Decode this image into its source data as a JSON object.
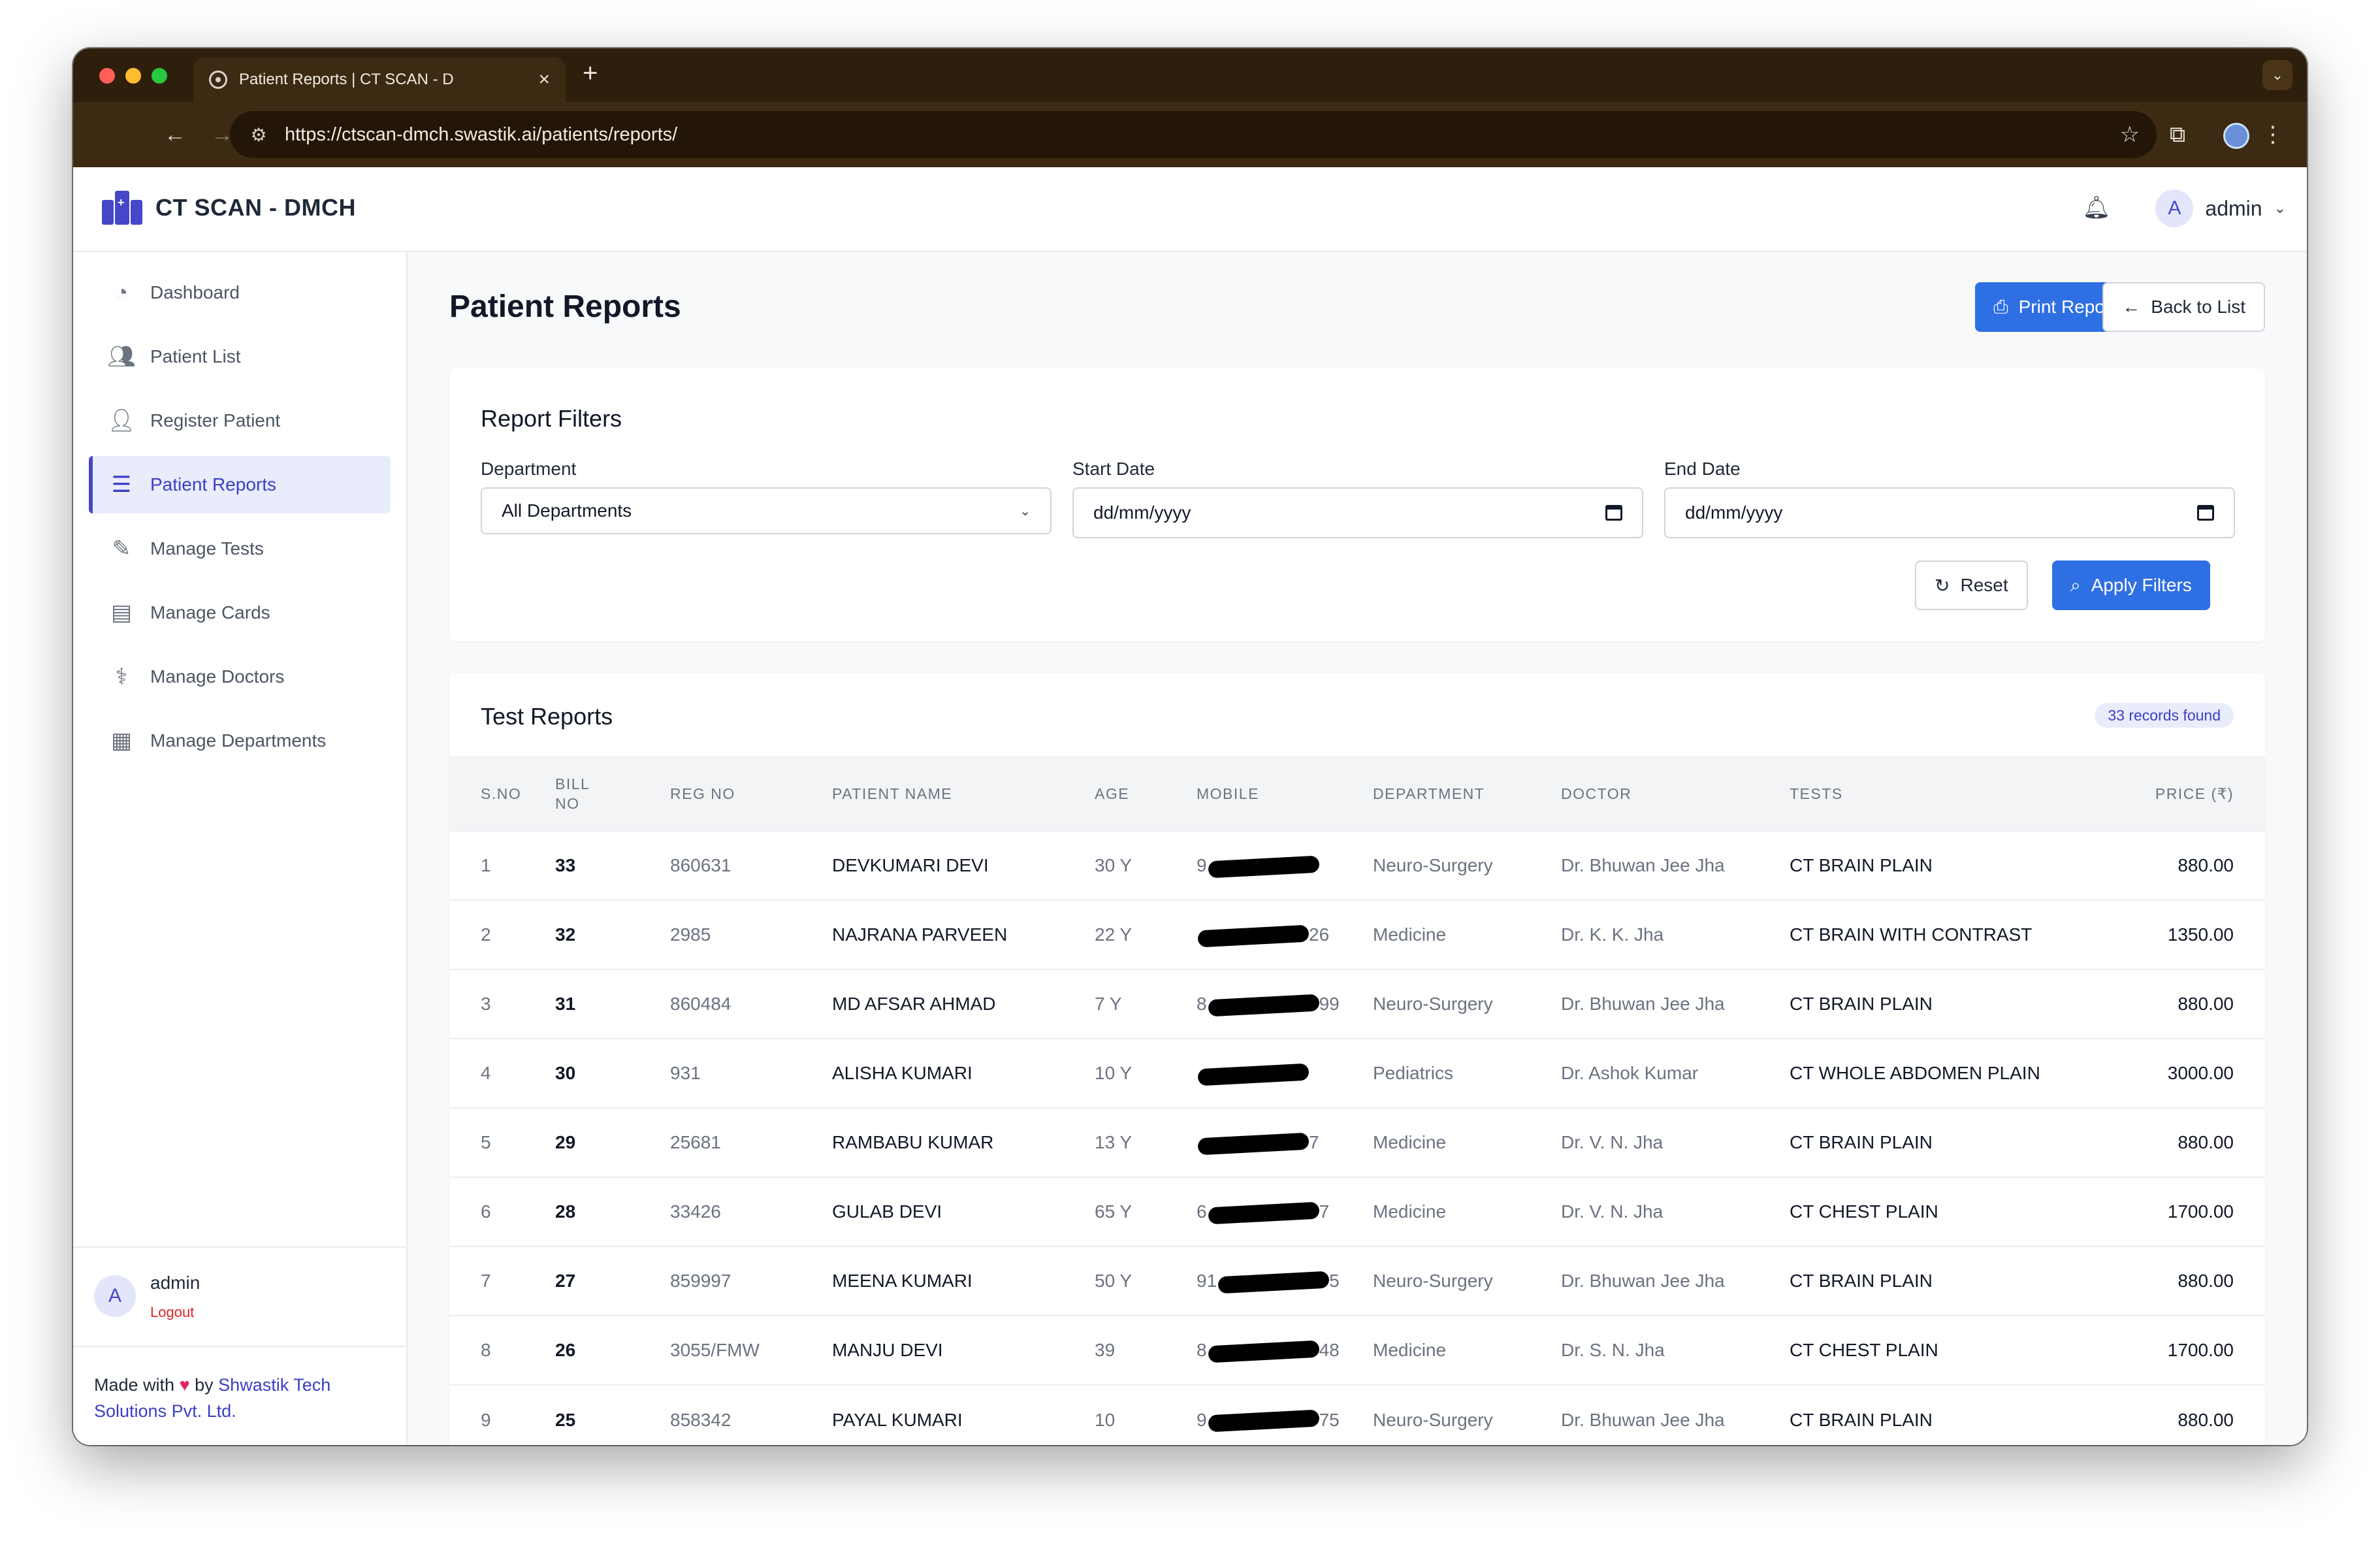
{
  "browser": {
    "tab_title": "Patient Reports | CT SCAN - D",
    "url": "https://ctscan-dmch.swastik.ai/patients/reports/"
  },
  "app": {
    "brand": "CT SCAN - DMCH",
    "user_name": "admin",
    "user_initial": "A"
  },
  "sidebar": {
    "items": [
      {
        "label": "Dashboard",
        "icon": "gauge-icon"
      },
      {
        "label": "Patient List",
        "icon": "users-icon"
      },
      {
        "label": "Register Patient",
        "icon": "user-plus-icon"
      },
      {
        "label": "Patient Reports",
        "icon": "chart-bar-icon"
      },
      {
        "label": "Manage Tests",
        "icon": "syringe-icon"
      },
      {
        "label": "Manage Cards",
        "icon": "id-card-icon"
      },
      {
        "label": "Manage Doctors",
        "icon": "user-doctor-icon"
      },
      {
        "label": "Manage Departments",
        "icon": "building-icon"
      }
    ],
    "footer_user": "admin",
    "footer_initial": "A",
    "logout": "Logout",
    "made_with_prefix": "Made with",
    "made_with_by": "by",
    "company": "Shwastik Tech Solutions Pvt. Ltd."
  },
  "page": {
    "title": "Patient Reports",
    "print_button": "Print Report",
    "back_button": "Back to List"
  },
  "filters": {
    "title": "Report Filters",
    "department_label": "Department",
    "department_value": "All Departments",
    "start_label": "Start Date",
    "start_value": "dd/mm/yyyy",
    "end_label": "End Date",
    "end_value": "dd/mm/yyyy",
    "reset": "Reset",
    "apply": "Apply Filters"
  },
  "reports": {
    "title": "Test Reports",
    "badge": "33 records found",
    "columns": {
      "sno": "S.NO",
      "bill_line1": "BILL",
      "bill_line2": "NO",
      "reg": "REG NO",
      "name": "PATIENT NAME",
      "age": "AGE",
      "mobile": "MOBILE",
      "dept": "DEPARTMENT",
      "doctor": "DOCTOR",
      "tests": "TESTS",
      "price": "PRICE (₹)"
    },
    "rows": [
      {
        "sno": "1",
        "bill": "33",
        "reg": "860631",
        "name": "DEVKUMARI DEVI",
        "age": "30 Y",
        "mob_a": "9",
        "mob_b": "",
        "dept": "Neuro-Surgery",
        "doctor": "Dr. Bhuwan Jee Jha",
        "test": "CT BRAIN PLAIN",
        "price": "880.00"
      },
      {
        "sno": "2",
        "bill": "32",
        "reg": "2985",
        "name": "NAJRANA PARVEEN",
        "age": "22 Y",
        "mob_a": "",
        "mob_b": "26",
        "dept": "Medicine",
        "doctor": "Dr. K. K. Jha",
        "test": "CT BRAIN WITH CONTRAST",
        "price": "1350.00"
      },
      {
        "sno": "3",
        "bill": "31",
        "reg": "860484",
        "name": "MD AFSAR AHMAD",
        "age": "7 Y",
        "mob_a": "8",
        "mob_b": "99",
        "dept": "Neuro-Surgery",
        "doctor": "Dr. Bhuwan Jee Jha",
        "test": "CT BRAIN PLAIN",
        "price": "880.00"
      },
      {
        "sno": "4",
        "bill": "30",
        "reg": "931",
        "name": "ALISHA KUMARI",
        "age": "10 Y",
        "mob_a": "",
        "mob_b": "",
        "dept": "Pediatrics",
        "doctor": "Dr. Ashok Kumar",
        "test": "CT WHOLE ABDOMEN PLAIN",
        "price": "3000.00"
      },
      {
        "sno": "5",
        "bill": "29",
        "reg": "25681",
        "name": "RAMBABU KUMAR",
        "age": "13 Y",
        "mob_a": "",
        "mob_b": "7",
        "dept": "Medicine",
        "doctor": "Dr. V. N. Jha",
        "test": "CT BRAIN PLAIN",
        "price": "880.00"
      },
      {
        "sno": "6",
        "bill": "28",
        "reg": "33426",
        "name": "GULAB DEVI",
        "age": "65 Y",
        "mob_a": "6",
        "mob_b": "7",
        "dept": "Medicine",
        "doctor": "Dr. V. N. Jha",
        "test": "CT CHEST PLAIN",
        "price": "1700.00"
      },
      {
        "sno": "7",
        "bill": "27",
        "reg": "859997",
        "name": "MEENA KUMARI",
        "age": "50 Y",
        "mob_a": "91",
        "mob_b": "5",
        "dept": "Neuro-Surgery",
        "doctor": "Dr. Bhuwan Jee Jha",
        "test": "CT BRAIN PLAIN",
        "price": "880.00"
      },
      {
        "sno": "8",
        "bill": "26",
        "reg": "3055/FMW",
        "name": "MANJU DEVI",
        "age": "39",
        "mob_a": "8",
        "mob_b": "48",
        "dept": "Medicine",
        "doctor": "Dr. S. N. Jha",
        "test": "CT CHEST PLAIN",
        "price": "1700.00"
      },
      {
        "sno": "9",
        "bill": "25",
        "reg": "858342",
        "name": "PAYAL KUMARI",
        "age": "10",
        "mob_a": "9",
        "mob_b": "75",
        "dept": "Neuro-Surgery",
        "doctor": "Dr. Bhuwan Jee Jha",
        "test": "CT BRAIN PLAIN",
        "price": "880.00"
      }
    ]
  }
}
